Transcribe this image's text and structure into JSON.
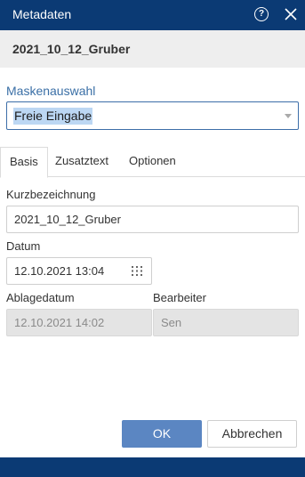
{
  "dialog": {
    "title": "Metadaten",
    "document_name": "2021_10_12_Gruber"
  },
  "mask": {
    "label": "Maskenauswahl",
    "selected": "Freie Eingabe"
  },
  "tabs": [
    {
      "label": "Basis",
      "active": true
    },
    {
      "label": "Zusatztext",
      "active": false
    },
    {
      "label": "Optionen",
      "active": false
    }
  ],
  "fields": {
    "kurzbezeichnung": {
      "label": "Kurzbezeichnung",
      "value": "2021_10_12_Gruber"
    },
    "datum": {
      "label": "Datum",
      "value": "12.10.2021 13:04"
    },
    "ablagedatum": {
      "label": "Ablagedatum",
      "value": "12.10.2021 14:02"
    },
    "bearbeiter": {
      "label": "Bearbeiter",
      "value": "Sen"
    }
  },
  "buttons": {
    "ok": "OK",
    "cancel": "Abbrechen"
  },
  "icons": {
    "help": "help-icon",
    "close": "close-icon",
    "calendar": "calendar-icon",
    "dropdown": "chevron-down-icon"
  },
  "colors": {
    "header": "#0b3a74",
    "accent": "#5b86c2",
    "label_blue": "#3a6fa6",
    "selection": "#bcd7f3"
  }
}
